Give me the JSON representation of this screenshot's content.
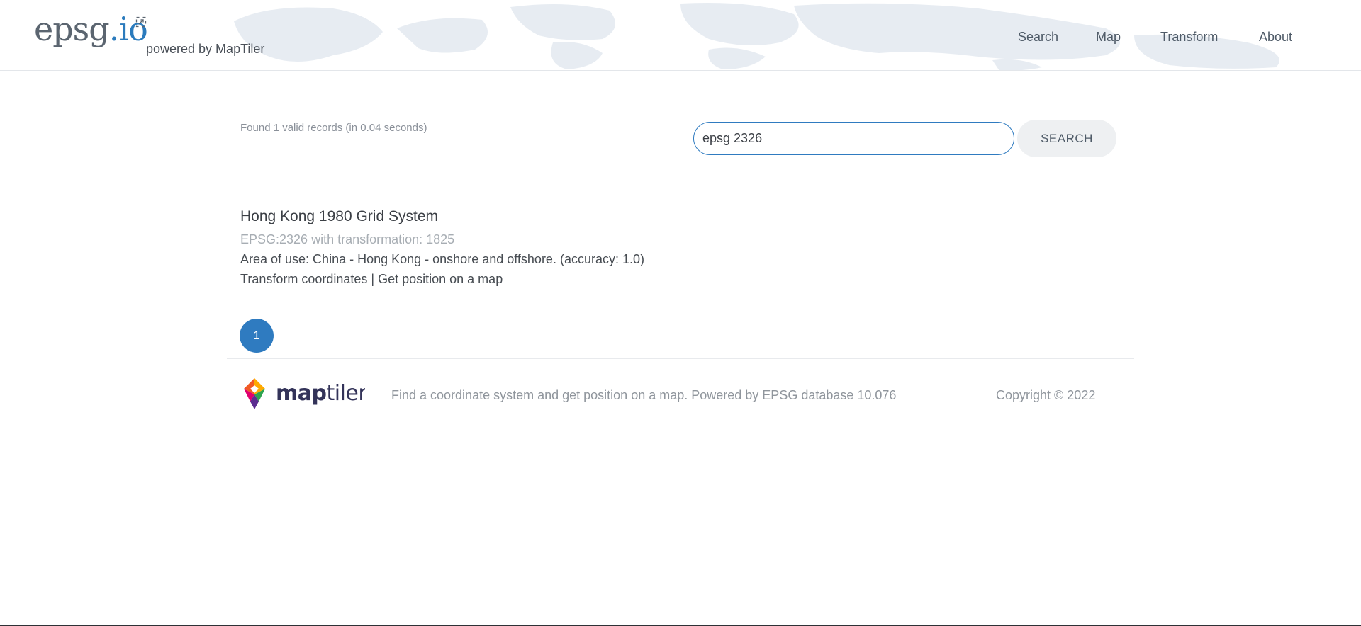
{
  "header": {
    "logo_main": "epsg",
    "logo_tld": ".io",
    "powered_by": "powered by MapTiler",
    "nav": [
      {
        "label": "Search"
      },
      {
        "label": "Map"
      },
      {
        "label": "Transform"
      },
      {
        "label": "About"
      }
    ]
  },
  "search": {
    "status": "Found 1 valid records (in 0.04 seconds)",
    "query": "epsg 2326",
    "button_label": "SEARCH"
  },
  "results": [
    {
      "title": "Hong Kong 1980 Grid System",
      "code_line": "EPSG:2326 with transformation: 1825",
      "area_line": "Area of use: China - Hong Kong - onshore and offshore. (accuracy: 1.0)",
      "link_transform": "Transform coordinates",
      "link_separator": " | ",
      "link_map": "Get position on a map"
    }
  ],
  "pagination": {
    "current_page": "1"
  },
  "footer": {
    "brand": "maptiler",
    "brand_bold": "map",
    "brand_light": "tiler",
    "description": "Find a coordinate system and get position on a map. Powered by EPSG database 10.076",
    "copyright": "Copyright © 2022"
  },
  "colors": {
    "accent": "#2f7bc0",
    "text": "#3b3f45",
    "muted": "#8f959c",
    "button_bg": "#eef0f2",
    "map_tint": "#dfe6ee"
  },
  "icons": {
    "logo_expand": "expand-icon"
  }
}
